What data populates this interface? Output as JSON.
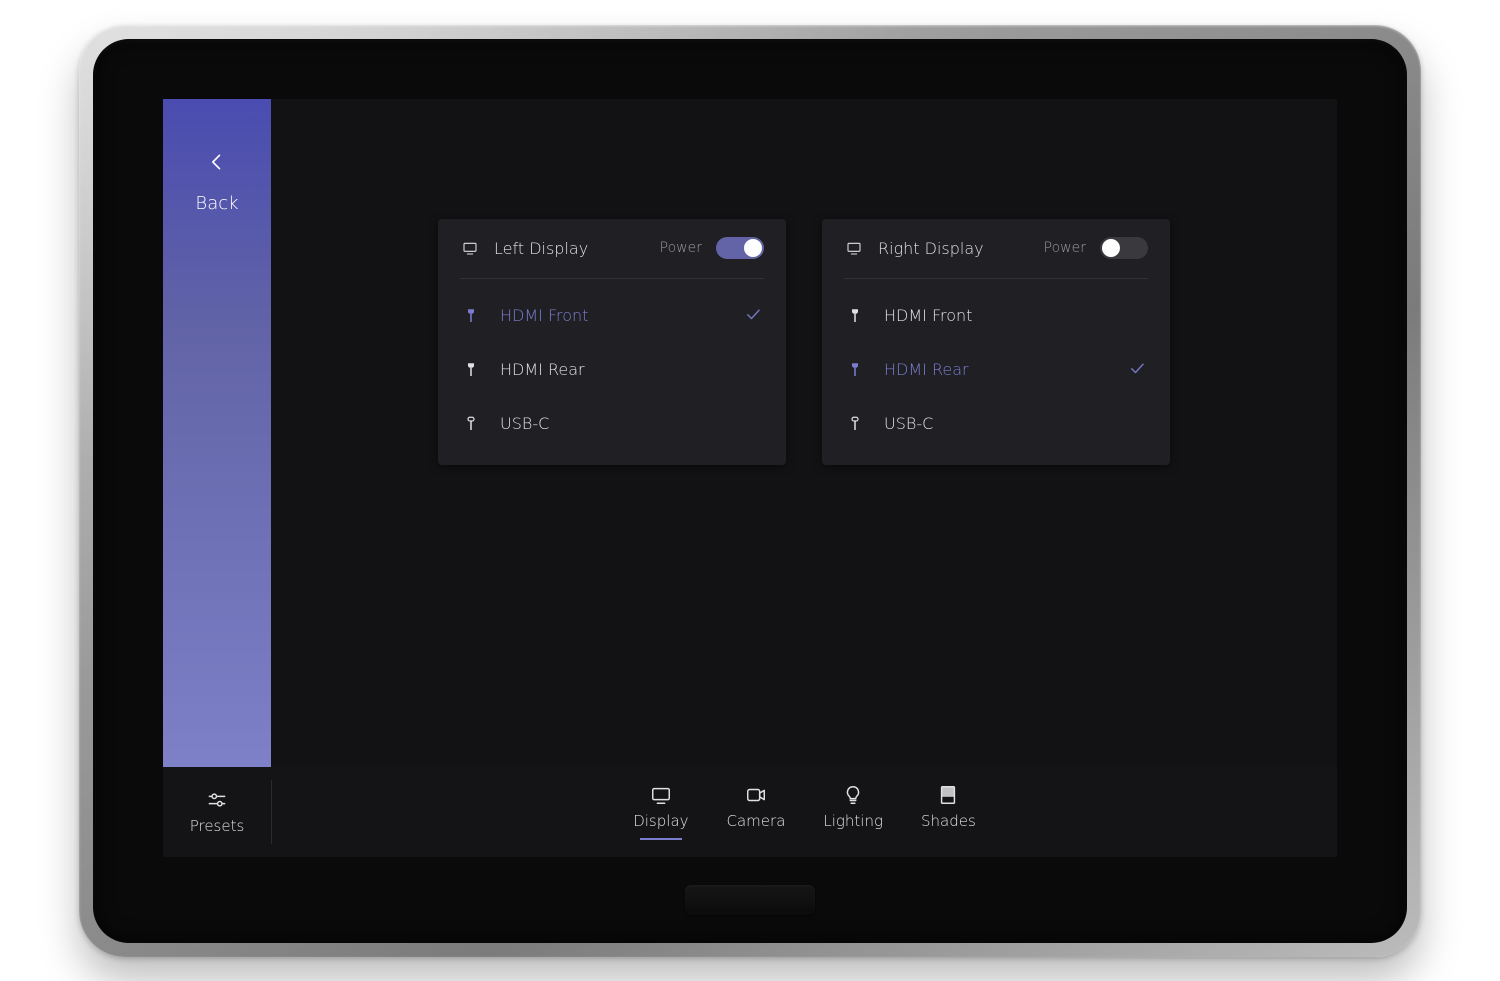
{
  "colors": {
    "accent": "#6264a7"
  },
  "sidebar": {
    "back_label": "Back"
  },
  "displays": [
    {
      "id": "left",
      "title": "Left Display",
      "power_label": "Power",
      "power_on": true,
      "selected": "HDMI Front",
      "sources": [
        {
          "label": "HDMI Front",
          "connector": "hdmi"
        },
        {
          "label": "HDMI Rear",
          "connector": "hdmi"
        },
        {
          "label": "USB-C",
          "connector": "usb-c"
        }
      ]
    },
    {
      "id": "right",
      "title": "Right Display",
      "power_label": "Power",
      "power_on": false,
      "selected": "HDMI Rear",
      "sources": [
        {
          "label": "HDMI Front",
          "connector": "hdmi"
        },
        {
          "label": "HDMI Rear",
          "connector": "hdmi"
        },
        {
          "label": "USB-C",
          "connector": "usb-c"
        }
      ]
    }
  ],
  "tabbar": {
    "presets_label": "Presets",
    "active": "Display",
    "tabs": [
      {
        "id": "display",
        "label": "Display",
        "icon": "monitor"
      },
      {
        "id": "camera",
        "label": "Camera",
        "icon": "camera"
      },
      {
        "id": "lighting",
        "label": "Lighting",
        "icon": "bulb"
      },
      {
        "id": "shades",
        "label": "Shades",
        "icon": "shades"
      }
    ]
  }
}
